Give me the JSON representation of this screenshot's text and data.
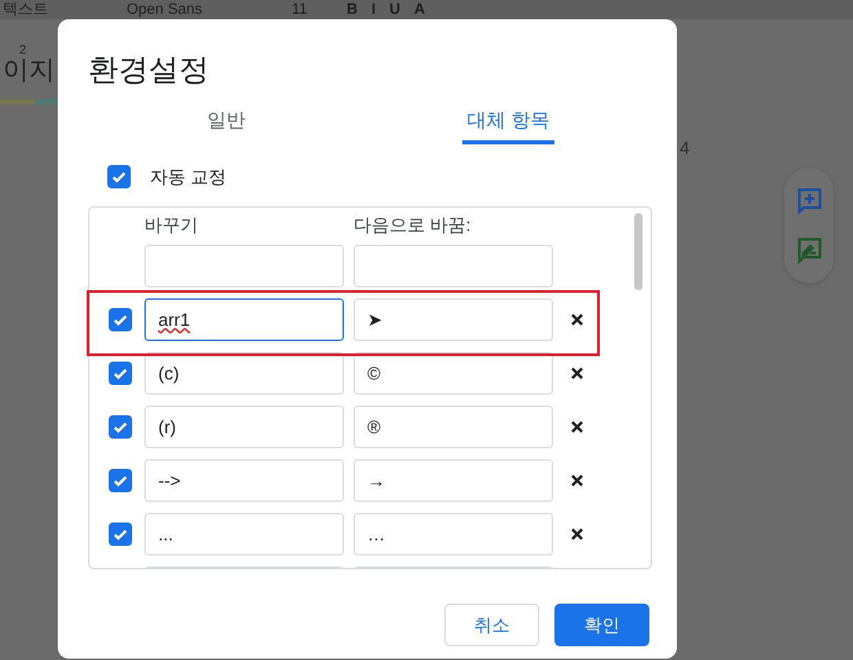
{
  "toolbar": {
    "style": "텍스트",
    "font": "Open Sans",
    "size": "11",
    "format_buttons": [
      "B",
      "I",
      "U",
      "A"
    ]
  },
  "ruler": {
    "mark": "2"
  },
  "document": {
    "text": "이지",
    "page_number": "4"
  },
  "dialog": {
    "title": "환경설정",
    "tabs": [
      {
        "label": "일반",
        "selected": false
      },
      {
        "label": "대체 항목",
        "selected": true
      }
    ],
    "autocorrect": {
      "label": "자동 교정",
      "checked": true
    },
    "columns": [
      "바꾸기",
      "다음으로 바꿈:"
    ],
    "rows": [
      {
        "replace": "arr1",
        "with": "➤",
        "checked": true,
        "focused": true,
        "misspelled": true,
        "highlighted": true
      },
      {
        "replace": "(c)",
        "with": "©",
        "checked": true,
        "focused": false,
        "misspelled": false,
        "highlighted": false
      },
      {
        "replace": "(r)",
        "with": "®",
        "checked": true,
        "focused": false,
        "misspelled": false,
        "highlighted": false
      },
      {
        "replace": "-->",
        "with": "→",
        "checked": true,
        "focused": false,
        "misspelled": false,
        "highlighted": false
      },
      {
        "replace": "...",
        "with": "…",
        "checked": true,
        "focused": false,
        "misspelled": false,
        "highlighted": false
      }
    ],
    "buttons": [
      {
        "label": "취소",
        "kind": "secondary"
      },
      {
        "label": "확인",
        "kind": "primary"
      }
    ]
  }
}
